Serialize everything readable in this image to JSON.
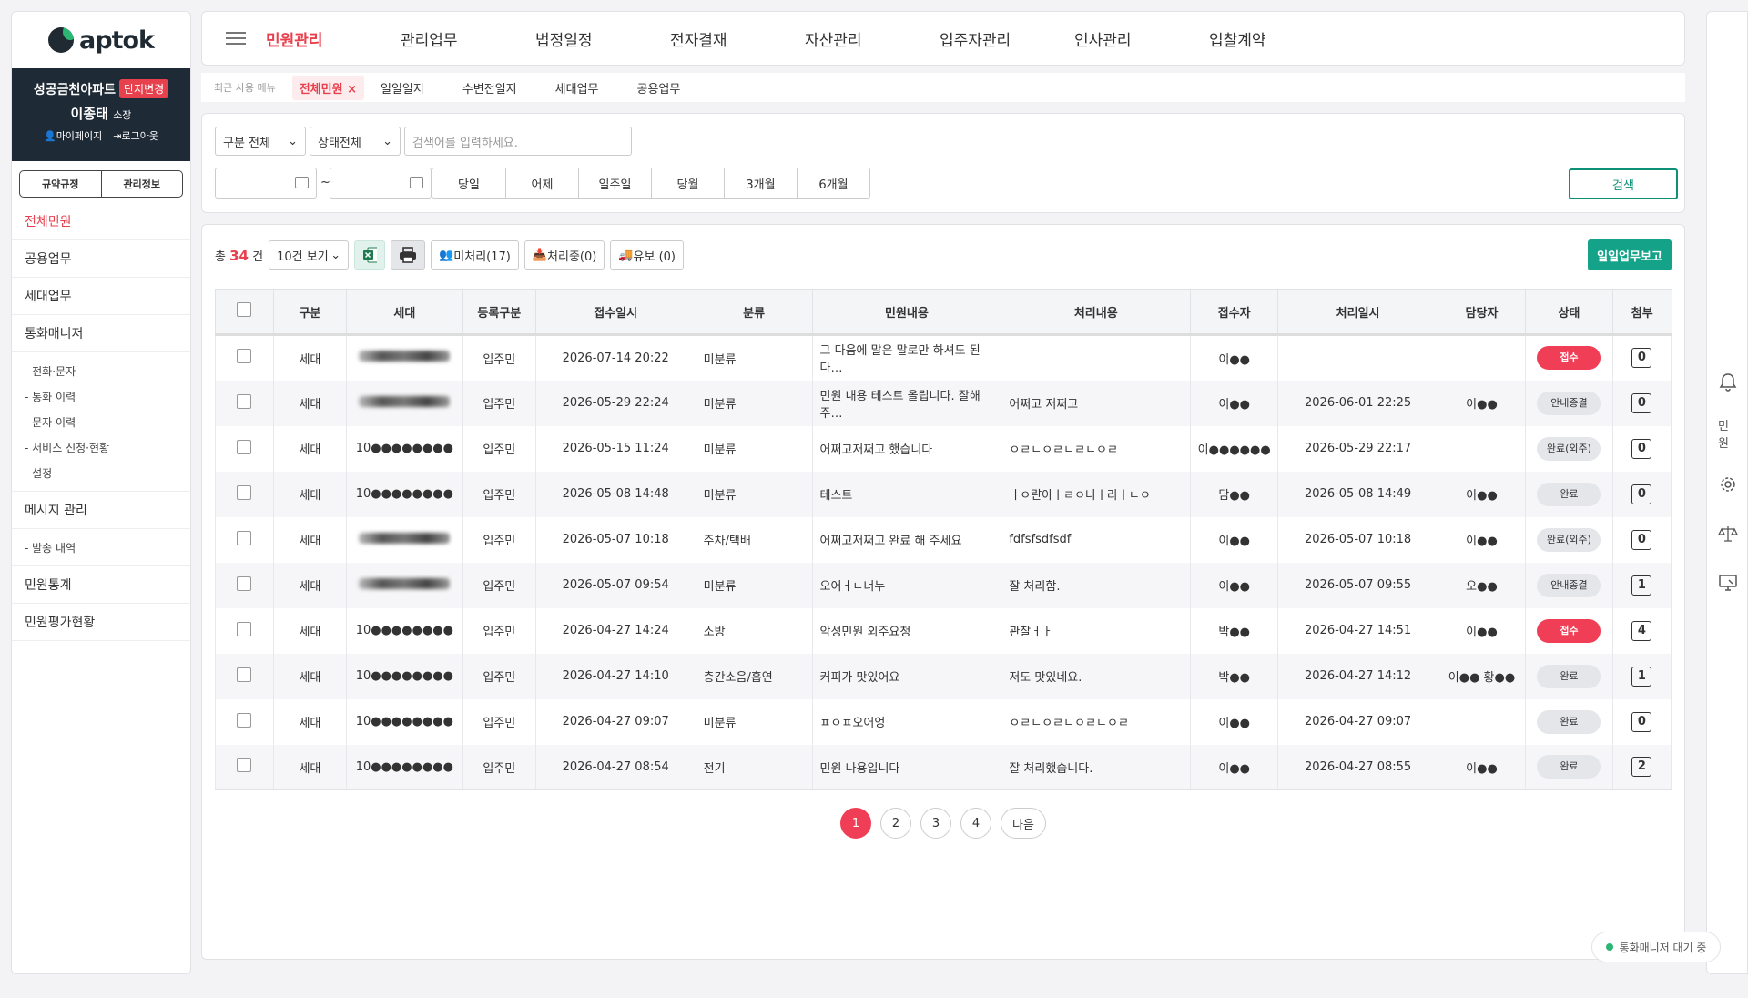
{
  "brand": {
    "logo_text": "aptok"
  },
  "profile": {
    "complex": "성공금천아파트",
    "change_badge": "단지변경",
    "name": "이종태",
    "title": "소장",
    "mypage": "마이페이지",
    "logout": "로그아웃"
  },
  "side_buttons": [
    "규약규정",
    "관리정보"
  ],
  "sidebar": {
    "item0": "전체민원",
    "item1": "공용업무",
    "item2": "세대업무",
    "item3": "통화매니저",
    "sub1": [
      "- 전화·문자",
      "- 통화 이력",
      "- 문자 이력",
      "- 서비스 신청·현황",
      "- 설정"
    ],
    "item4": "메시지 관리",
    "sub2": [
      "- 발송 내역"
    ],
    "item5": "민원통계",
    "item6": "민원평가현황"
  },
  "topnav": [
    "민원관리",
    "관리업무",
    "법정일정",
    "전자결재",
    "자산관리",
    "입주자관리",
    "인사관리",
    "입찰계약"
  ],
  "tabbar": {
    "recent_label": "최근 사용 메뉴",
    "active_tab": "전체민원",
    "tabs": [
      "일일일지",
      "수변전일지",
      "세대업무",
      "공용업무"
    ]
  },
  "search": {
    "category_select": "구분 전체",
    "status_select": "상태전체",
    "placeholder": "검색어를 입력하세요.",
    "date_sep": "~",
    "quick": [
      "당일",
      "어제",
      "일주일",
      "당월",
      "3개월",
      "6개월"
    ],
    "search_button": "검색"
  },
  "toolbar": {
    "total_prefix": "총",
    "total_count": "34",
    "total_suffix": "건",
    "page_size": "10건 보기",
    "unprocessed": "미처리(17)",
    "processing": "처리중(0)",
    "hold": "유보 (0)",
    "daily_report": "일일업무보고"
  },
  "table": {
    "headers": [
      "구분",
      "세대",
      "등록구분",
      "접수일시",
      "분류",
      "민원내용",
      "처리내용",
      "접수자",
      "처리일시",
      "담당자",
      "상태",
      "첨부"
    ],
    "rows": [
      {
        "type": "세대",
        "unit": "",
        "reg": "입주민",
        "received": "2026-07-14 20:22",
        "category": "미분류",
        "content": "그 다음에 말은 말로만 하셔도 된다…",
        "result": "",
        "receiver": "이●●",
        "processed": "",
        "manager": "",
        "status": "접수",
        "attach": "0"
      },
      {
        "type": "세대",
        "unit": "",
        "reg": "입주민",
        "received": "2026-05-29 22:24",
        "category": "미분류",
        "content": "민원 내용 테스트 올립니다. 잘해 주…",
        "result": "어쩌고 저쩌고",
        "receiver": "이●●",
        "processed": "2026-06-01 22:25",
        "manager": "이●●",
        "status": "안내종결",
        "attach": "0"
      },
      {
        "type": "세대",
        "unit": "10●●●●●●●●",
        "reg": "입주민",
        "received": "2026-05-15 11:24",
        "category": "미분류",
        "content": "어쩌고저쩌고 했습니다",
        "result": "ㅇㄹㄴㅇㄹㄴㄹㄴㅇㄹ",
        "receiver": "이●●●●●●",
        "processed": "2026-05-29 22:17",
        "manager": "",
        "status": "완료(외주)",
        "attach": "0"
      },
      {
        "type": "세대",
        "unit": "10●●●●●●●●",
        "reg": "입주민",
        "received": "2026-05-08 14:48",
        "category": "미분류",
        "content": "테스트",
        "result": "ㅓㅇ랸아ㅣㄹㅇ나ㅣ라ㅣㄴㅇ",
        "receiver": "담●●",
        "processed": "2026-05-08 14:49",
        "manager": "이●●",
        "status": "완료",
        "attach": "0"
      },
      {
        "type": "세대",
        "unit": "",
        "reg": "입주민",
        "received": "2026-05-07 10:18",
        "category": "주차/택배",
        "content": "어쩌고저쩌고 완료 해 주세요",
        "result": "fdfsfsdfsdf",
        "receiver": "이●●",
        "processed": "2026-05-07 10:18",
        "manager": "이●●",
        "status": "완료(외주)",
        "attach": "0"
      },
      {
        "type": "세대",
        "unit": "",
        "reg": "입주민",
        "received": "2026-05-07 09:54",
        "category": "미분류",
        "content": "오어ㅓㄴ너누",
        "result": "잘 처리함.",
        "receiver": "이●●",
        "processed": "2026-05-07 09:55",
        "manager": "오●●",
        "status": "안내종결",
        "attach": "1"
      },
      {
        "type": "세대",
        "unit": "10●●●●●●●●",
        "reg": "입주민",
        "received": "2026-04-27 14:24",
        "category": "소방",
        "content": "악성민원 외주요청",
        "result": "관찰ㅓㅏ",
        "receiver": "박●●",
        "processed": "2026-04-27 14:51",
        "manager": "이●●",
        "status": "접수",
        "attach": "4"
      },
      {
        "type": "세대",
        "unit": "10●●●●●●●●",
        "reg": "입주민",
        "received": "2026-04-27 14:10",
        "category": "층간소음/흡연",
        "content": "커피가 맛있어요",
        "result": "저도 맛있네요.",
        "receiver": "박●●",
        "processed": "2026-04-27 14:12",
        "manager": "이●● 황●●",
        "status": "완료",
        "attach": "1"
      },
      {
        "type": "세대",
        "unit": "10●●●●●●●●",
        "reg": "입주민",
        "received": "2026-04-27 09:07",
        "category": "미분류",
        "content": "ㅍㅇㅍ오어엉",
        "result": "ㅇㄹㄴㅇㄹㄴㅇㄹㄴㅇㄹ",
        "receiver": "이●●",
        "processed": "2026-04-27 09:07",
        "manager": "",
        "status": "완료",
        "attach": "0"
      },
      {
        "type": "세대",
        "unit": "10●●●●●●●●",
        "reg": "입주민",
        "received": "2026-04-27 08:54",
        "category": "전기",
        "content": "민원 나용입니다",
        "result": "잘 처리했습니다.",
        "receiver": "이●●",
        "processed": "2026-04-27 08:55",
        "manager": "이●●",
        "status": "완료",
        "attach": "2"
      }
    ]
  },
  "pagination": {
    "pages": [
      "1",
      "2",
      "3",
      "4"
    ],
    "next": "다음"
  },
  "right_rail": {
    "complaint_label": "민원"
  },
  "call_status": "통화매니저 대기 중",
  "colors": {
    "accent": "#e8414e",
    "primary": "#14a388",
    "sidebar_dark": "#1e2a36"
  },
  "icons": [
    "hamburger-icon",
    "calendar-icon",
    "excel-icon",
    "print-icon",
    "user-icon",
    "inbox-icon",
    "truck-icon",
    "bell-icon",
    "gear-icon",
    "scale-icon",
    "monitor-icon"
  ]
}
